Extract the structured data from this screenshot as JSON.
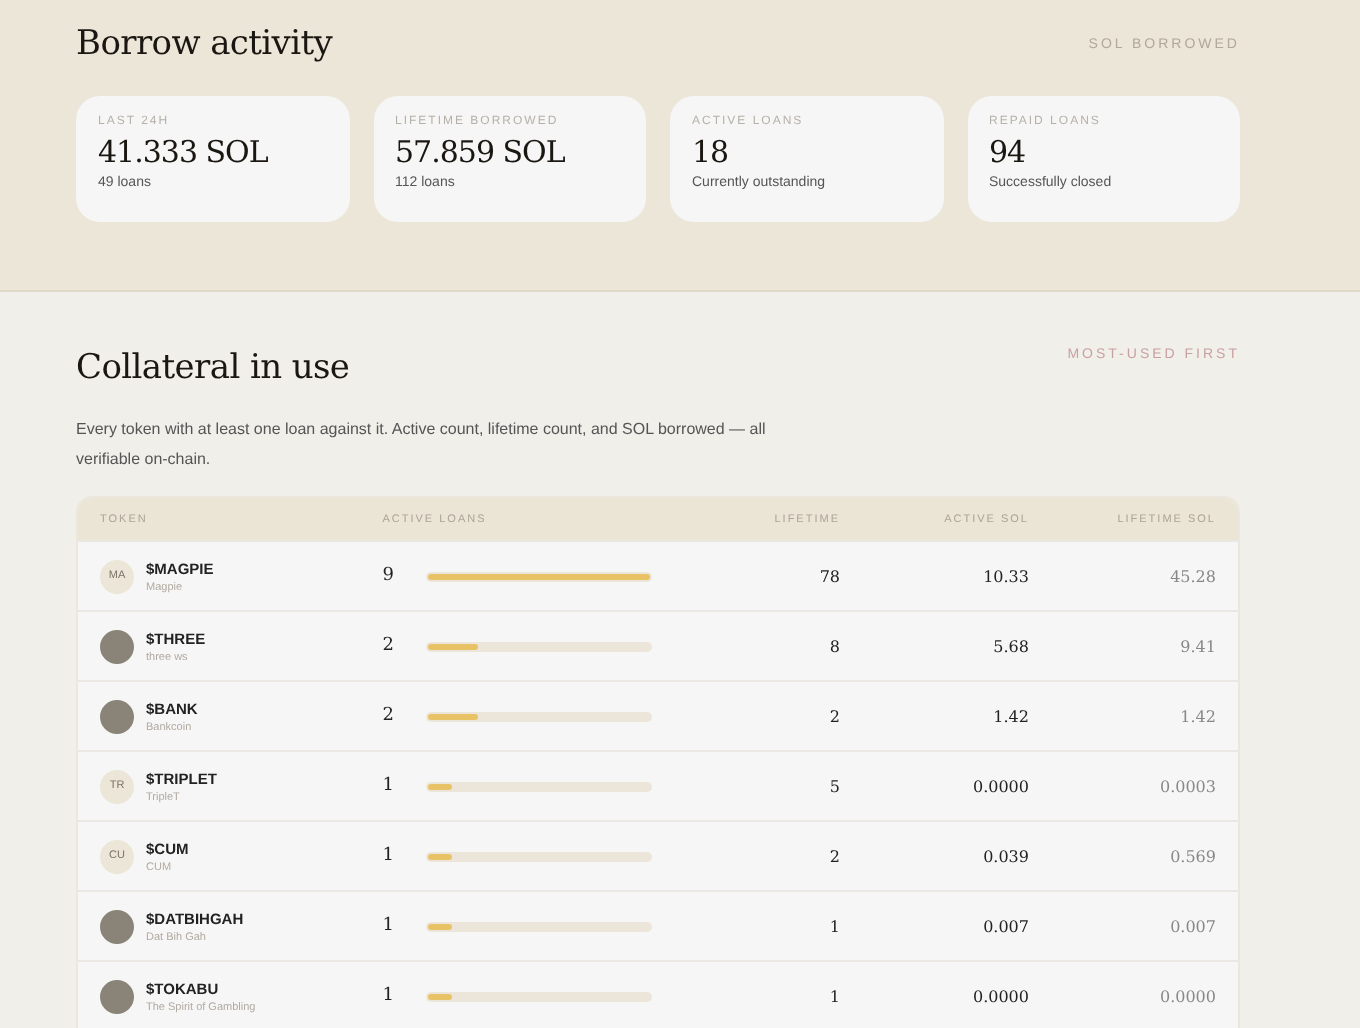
{
  "borrow_activity": {
    "title": "Borrow activity",
    "tag": "SOL BORROWED",
    "stats": [
      {
        "label": "LAST 24H",
        "value": "41.333 SOL",
        "note": "49 loans"
      },
      {
        "label": "LIFETIME BORROWED",
        "value": "57.859 SOL",
        "note": "112 loans"
      },
      {
        "label": "ACTIVE LOANS",
        "value": "18",
        "note": "Currently outstanding"
      },
      {
        "label": "REPAID LOANS",
        "value": "94",
        "note": "Successfully closed"
      }
    ]
  },
  "collateral": {
    "title": "Collateral in use",
    "tag": "MOST-USED FIRST",
    "description": "Every token with at least one loan against it. Active count, lifetime count, and SOL borrowed — all verifiable on-chain.",
    "table": {
      "columns": [
        "TOKEN",
        "ACTIVE LOANS",
        "LIFETIME",
        "ACTIVE SOL",
        "LIFETIME SOL"
      ],
      "rows": [
        {
          "avatar": {
            "kind": "initials",
            "text": "MA"
          },
          "symbol": "$MAGPIE",
          "name": "Magpie",
          "active": "9",
          "level": 1,
          "lifetime": "78",
          "active_sol": "10.33",
          "lifetime_sol": "45.28"
        },
        {
          "avatar": {
            "kind": "image"
          },
          "symbol": "$THREE",
          "name": "three ws",
          "active": "2",
          "level": 0.22,
          "lifetime": "8",
          "active_sol": "5.68",
          "lifetime_sol": "9.41"
        },
        {
          "avatar": {
            "kind": "image"
          },
          "symbol": "$BANK",
          "name": "Bankcoin",
          "active": "2",
          "level": 0.22,
          "lifetime": "2",
          "active_sol": "1.42",
          "lifetime_sol": "1.42"
        },
        {
          "avatar": {
            "kind": "initials",
            "text": "TR"
          },
          "symbol": "$TRIPLET",
          "name": "TripleT",
          "active": "1",
          "level": 0.11,
          "lifetime": "5",
          "active_sol": "0.0000",
          "lifetime_sol": "0.0003"
        },
        {
          "avatar": {
            "kind": "initials",
            "text": "CU"
          },
          "symbol": "$CUM",
          "name": "CUM",
          "active": "1",
          "level": 0.11,
          "lifetime": "2",
          "active_sol": "0.039",
          "lifetime_sol": "0.569"
        },
        {
          "avatar": {
            "kind": "image"
          },
          "symbol": "$DATBIHGAH",
          "name": "Dat Bih Gah",
          "active": "1",
          "level": 0.11,
          "lifetime": "1",
          "active_sol": "0.007",
          "lifetime_sol": "0.007"
        },
        {
          "avatar": {
            "kind": "image"
          },
          "symbol": "$TOKABU",
          "name": "The Spirit of Gambling",
          "active": "1",
          "level": 0.11,
          "lifetime": "1",
          "active_sol": "0.0000",
          "lifetime_sol": "0.0000"
        }
      ]
    }
  }
}
